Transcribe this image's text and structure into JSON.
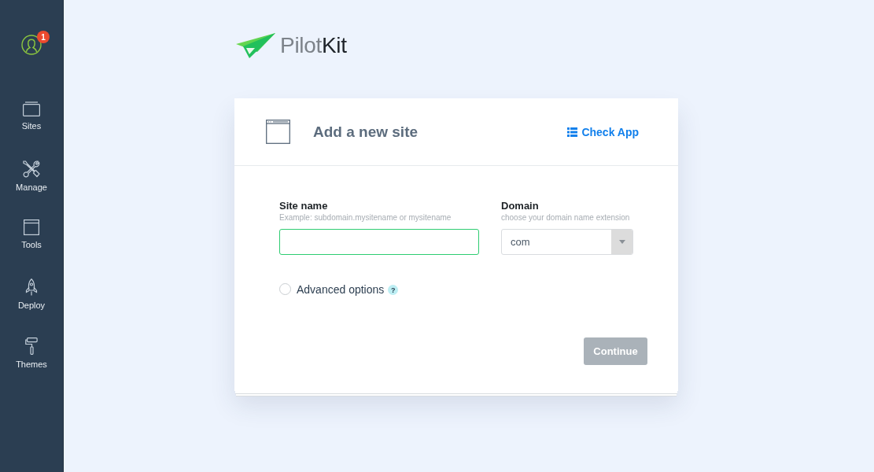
{
  "sidebar": {
    "notification_badge": "1",
    "items": [
      {
        "label": "Sites"
      },
      {
        "label": "Manage"
      },
      {
        "label": "Tools"
      },
      {
        "label": "Deploy"
      },
      {
        "label": "Themes"
      }
    ]
  },
  "logo": {
    "text": "Pilot**Kit**"
  },
  "card": {
    "title": "Add a new site",
    "link": "Check App",
    "fields": [
      {
        "kind": "text",
        "label": "Site name",
        "hint": "Example: subdomain.mysitename or mysitename",
        "focused": true
      },
      {
        "kind": "select",
        "label": "Domain",
        "hint": "choose your domain name extension",
        "value": "com"
      }
    ],
    "advanced": {
      "label": "Advanced options",
      "checked": false,
      "help": "?"
    },
    "continue": {
      "label": "Continue",
      "disabled": true
    }
  }
}
